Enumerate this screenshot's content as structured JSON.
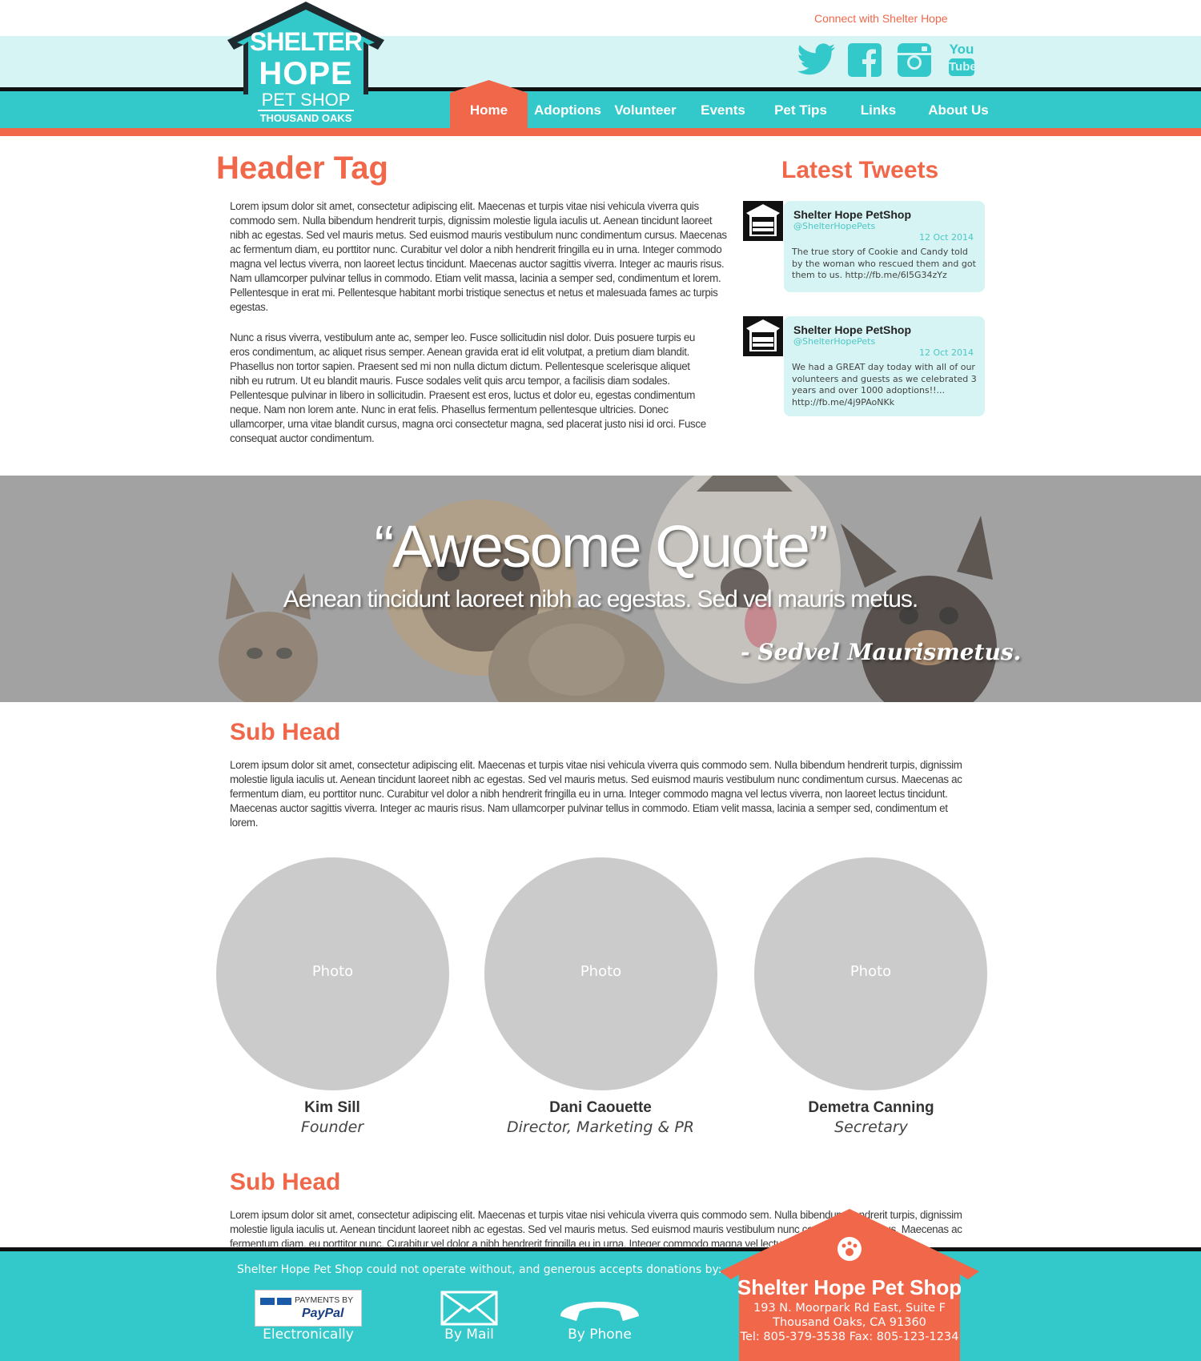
{
  "header": {
    "connect_label": "Connect with Shelter Hope",
    "logo": {
      "line1": "SHELTER",
      "line2": "HOPE",
      "line3": "PET SHOP",
      "line4": "THOUSAND OAKS"
    },
    "social": [
      "twitter-icon",
      "facebook-icon",
      "instagram-icon",
      "youtube-icon"
    ],
    "youtube_top": "You",
    "youtube_bottom": "Tube"
  },
  "nav": {
    "items": [
      {
        "label": "Home",
        "active": true
      },
      {
        "label": "Adoptions"
      },
      {
        "label": "Volunteer"
      },
      {
        "label": "Events"
      },
      {
        "label": "Pet Tips"
      },
      {
        "label": "Links"
      },
      {
        "label": "About Us"
      }
    ]
  },
  "main": {
    "header_tag": "Header Tag",
    "paragraph1": "Lorem ipsum dolor sit amet, consectetur adipiscing elit. Maecenas et turpis vitae nisi vehicula viverra quis commodo sem. Nulla bibendum hendrerit turpis, dignissim molestie ligula iaculis ut. Aenean tincidunt laoreet nibh ac egestas. Sed vel mauris metus. Sed euismod mauris vestibulum nunc condimentum cursus. Maecenas ac fermentum diam, eu porttitor nunc. Curabitur vel dolor a nibh hendrerit fringilla eu in urna. Integer commodo magna vel lectus viverra, non laoreet lectus tincidunt. Maecenas auctor sagittis viverra. Integer ac mauris risus. Nam ullamcorper pulvinar tellus in commodo. Etiam velit massa, lacinia a semper sed, condimentum et lorem. Pellentesque in erat mi. Pellentesque habitant morbi tristique senectus et netus et malesuada fames ac turpis egestas.",
    "paragraph2": "Nunc a risus viverra, vestibulum ante ac, semper leo. Fusce sollicitudin nisl dolor. Duis posuere turpis eu eros condimentum, ac aliquet risus semper. Aenean gravida erat id elit volutpat, a pretium diam blandit. Phasellus non tortor sapien. Praesent sed mi non nulla dictum dictum. Pellentesque scelerisque aliquet nibh eu rutrum. Ut eu blandit mauris. Fusce sodales velit quis arcu tempor, a facilisis diam sodales. Pellentesque pulvinar in libero in sollicitudin. Praesent est eros, luctus et dolor eu, egestas condimentum neque. Nam non lorem ante. Nunc in erat felis. Phasellus fermentum pellentesque ultricies. Donec ullamcorper, urna vitae blandit cursus, magna orci consectetur magna, sed placerat justo nisi id orci. Fusce consequat auctor condimentum."
  },
  "tweets": {
    "title": "Latest Tweets",
    "items": [
      {
        "name": "Shelter Hope PetShop",
        "handle": "@ShelterHopePets",
        "date": "12 Oct 2014",
        "text": "The true story of Cookie and Candy told by the woman who rescued them and got them to us. http://fb.me/6I5G34zYz"
      },
      {
        "name": "Shelter Hope PetShop",
        "handle": "@ShelterHopePets",
        "date": "12 Oct 2014",
        "text": "We had a GREAT day today with all of our volunteers and guests as we celebrated 3 years and over 1000 adoptions!!... http://fb.me/4j9PAoNKk"
      }
    ]
  },
  "banner": {
    "quote": "“Awesome Quote”",
    "subtext": "Aenean tincidunt laoreet nibh ac egestas. Sed vel mauris metus.",
    "author": "- Sedvel Maurismetus."
  },
  "section2": {
    "subhead": "Sub Head",
    "paragraph": "Lorem ipsum dolor sit amet, consectetur adipiscing elit. Maecenas et turpis vitae nisi vehicula viverra quis commodo sem. Nulla bibendum hendrerit turpis, dignissim molestie ligula iaculis ut. Aenean tincidunt laoreet nibh ac egestas. Sed vel mauris metus. Sed euismod mauris vestibulum nunc condimentum cursus. Maecenas ac fermentum diam, eu porttitor nunc. Curabitur vel dolor a nibh hendrerit fringilla eu in urna. Integer commodo magna vel lectus viverra, non laoreet lectus tincidunt. Maecenas auctor sagittis viverra. Integer ac mauris risus. Nam ullamcorper pulvinar tellus in commodo. Etiam velit massa, lacinia a semper sed, condimentum et lorem."
  },
  "team": [
    {
      "photo_label": "Photo",
      "name": "Kim Sill",
      "role": "Founder"
    },
    {
      "photo_label": "Photo",
      "name": "Dani Caouette",
      "role": "Director, Marketing & PR"
    },
    {
      "photo_label": "Photo",
      "name": "Demetra Canning",
      "role": "Secretary"
    }
  ],
  "section3": {
    "subhead": "Sub Head",
    "paragraph": "Lorem ipsum dolor sit amet, consectetur adipiscing elit. Maecenas et turpis vitae nisi vehicula viverra quis commodo sem. Nulla bibendum hendrerit turpis, dignissim molestie ligula iaculis ut. Aenean tincidunt laoreet nibh ac egestas. Sed vel mauris metus. Sed euismod mauris vestibulum nunc condimentum cursus. Maecenas ac fermentum diam, eu porttitor nunc. Curabitur vel dolor a nibh hendrerit fringilla eu in urna. Integer commodo magna vel lectus viverra,"
  },
  "footer": {
    "note": "Shelter Hope Pet Shop could not operate without, and generous accepts donations by:",
    "paypal_top": "PAYMENTS BY",
    "paypal_brand": "PayPal",
    "donate": [
      "Electronically",
      "By Mail",
      "By Phone"
    ],
    "org_name": "Shelter Hope Pet Shop",
    "address1": "193 N. Moorpark Rd East, Suite F",
    "address2": "Thousand Oaks, CA 91360",
    "contact": "Tel: 805-379-3538  Fax: 805-123-1234"
  },
  "colors": {
    "teal": "#33c8c9",
    "light_teal": "#d6f4f3",
    "orange": "#f0674a",
    "photo_gray": "#cbcbcb"
  }
}
